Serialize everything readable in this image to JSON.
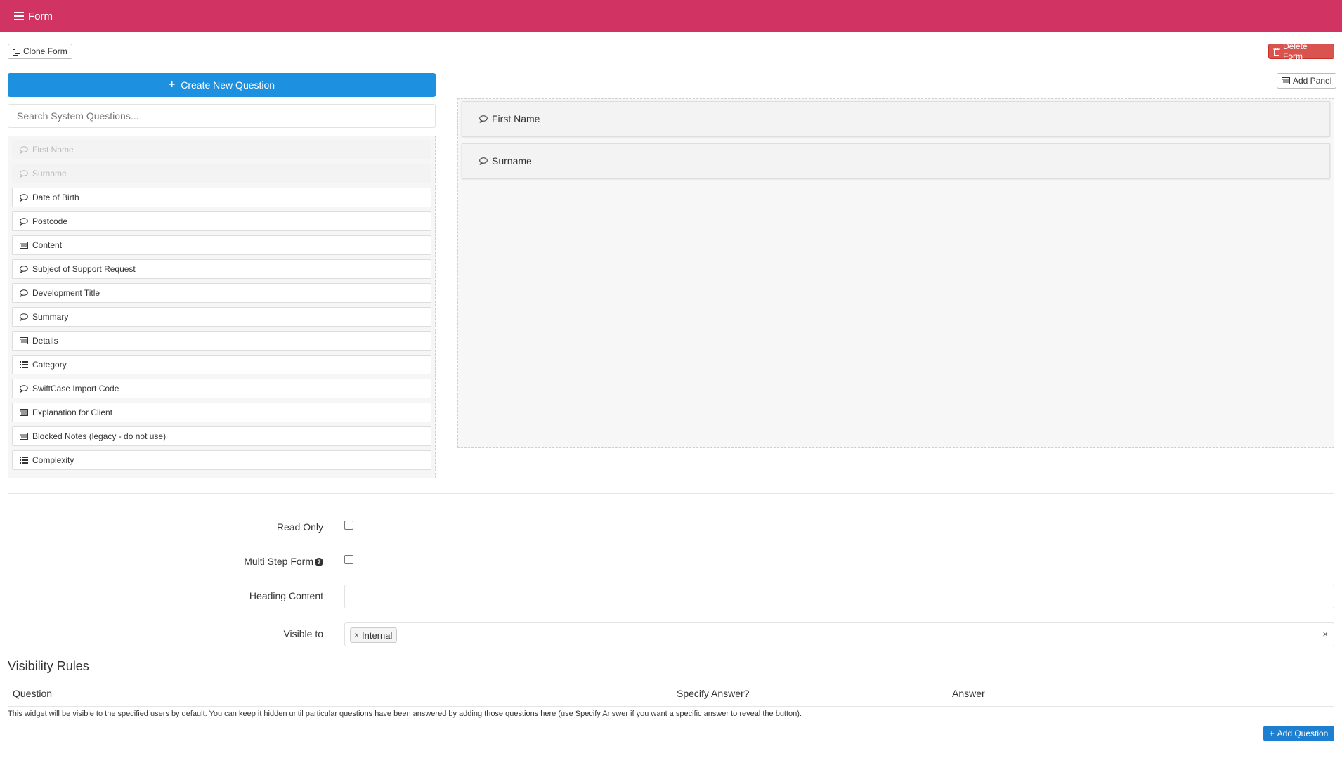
{
  "header": {
    "title": "Form"
  },
  "toolbar": {
    "clone_label": "Clone Form",
    "delete_label": "Delete Form",
    "add_panel_label": "Add Panel"
  },
  "left": {
    "create_label": "Create New Question",
    "search_placeholder": "Search System Questions...",
    "questions": [
      {
        "label": "First Name",
        "icon": "comment-icon",
        "used": true
      },
      {
        "label": "Surname",
        "icon": "comment-icon",
        "used": true
      },
      {
        "label": "Date of Birth",
        "icon": "comment-icon",
        "used": false
      },
      {
        "label": "Postcode",
        "icon": "comment-icon",
        "used": false
      },
      {
        "label": "Content",
        "icon": "panel-icon",
        "used": false
      },
      {
        "label": "Subject of Support Request",
        "icon": "comment-icon",
        "used": false
      },
      {
        "label": "Development Title",
        "icon": "comment-icon",
        "used": false
      },
      {
        "label": "Summary",
        "icon": "comment-icon",
        "used": false
      },
      {
        "label": "Details",
        "icon": "panel-icon",
        "used": false
      },
      {
        "label": "Category",
        "icon": "list-icon",
        "used": false
      },
      {
        "label": "SwiftCase Import Code",
        "icon": "comment-icon",
        "used": false
      },
      {
        "label": "Explanation for Client",
        "icon": "panel-icon",
        "used": false
      },
      {
        "label": "Blocked Notes (legacy - do not use)",
        "icon": "panel-icon",
        "used": false
      },
      {
        "label": "Complexity",
        "icon": "list-icon",
        "used": false
      }
    ]
  },
  "canvas": {
    "panels": [
      {
        "label": "First Name",
        "icon": "comment-icon"
      },
      {
        "label": "Surname",
        "icon": "comment-icon"
      }
    ]
  },
  "settings": {
    "read_only_label": "Read Only",
    "read_only_checked": false,
    "multi_step_label": "Multi Step Form",
    "multi_step_checked": false,
    "heading_label": "Heading Content",
    "heading_value": "",
    "visible_label": "Visible to",
    "visible_tags": [
      "Internal"
    ]
  },
  "visibility_rules": {
    "title": "Visibility Rules",
    "columns": [
      "Question",
      "Specify Answer?",
      "Answer"
    ],
    "help_text": "This widget will be visible to the specified users by default. You can keep it hidden until particular questions have been answered by adding those questions here (use Specify Answer if you want a specific answer to reveal the button).",
    "add_label": "Add Question"
  },
  "colors": {
    "header": "#d13462",
    "primary": "#1e90e0",
    "danger": "#d9534f"
  }
}
